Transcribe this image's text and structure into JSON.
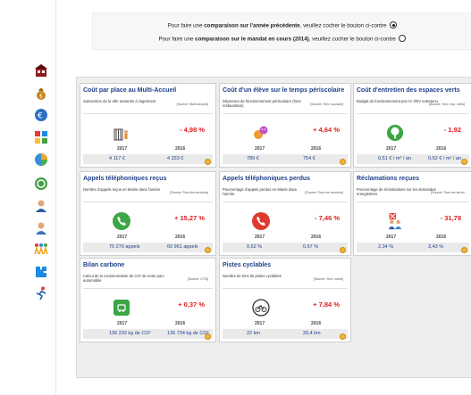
{
  "header": {
    "line1": {
      "pre": "Pour faire une ",
      "bold": "comparaison sur l'année précédente",
      "post": ", veuillez cocher le bouton ci-contre"
    },
    "line2": {
      "pre": "Pour faire une ",
      "bold": "comparaison sur le mandat en cours (2014)",
      "post": ", veuillez cocher le bouton ci-contre"
    }
  },
  "sidebar_icons": [
    "building-icon",
    "money-bag-icon",
    "euro-icon",
    "puzzle-pieces-icon",
    "pie-chart-icon",
    "recycle-icon",
    "user-icon",
    "user-group-icon",
    "people-chain-icon",
    "puzzle-icon",
    "runner-icon"
  ],
  "colors": {
    "title": "#1f3f8a",
    "negative": "#e11b1b",
    "green": "#3aa645",
    "red": "#e03a2f"
  },
  "cards": [
    {
      "title": "Coût par place au Multi-Accueil",
      "subtitle": "Subvention de la ville ramenée à l'agrément",
      "source": "[Source: Multi-accueil]",
      "icon": "child-with-crib-icon",
      "delta": "- 4,98 %",
      "year1": "2017",
      "year2": "2016",
      "value1": "4 117  €",
      "value2": "4 333  €"
    },
    {
      "title": "Coût d'un élève sur le temps périscolaire",
      "subtitle": "Dépenses de fonctionnement périscolaire (hors restauration)",
      "source": "[Source: Serv. scolaire]",
      "icon": "theater-masks-icon",
      "delta": "+ 4,64  %",
      "year1": "2017",
      "year2": "2016",
      "value1": "789  €",
      "value2": "754  €"
    },
    {
      "title": "Coût d'entretien des espaces verts",
      "subtitle": "Budget de fonctionnement par m² d'EV entretenu",
      "source": "[Source: Serv. esp. verts]",
      "icon": "tree-icon",
      "delta": "- 1,92",
      "year1": "2017",
      "year2": "2016",
      "value1": "0,51  € / m² / an",
      "value2": "0,52  € / m² / an"
    },
    {
      "title": "Appels téléphoniques reçus",
      "subtitle": "Nombre d'appels reçus en Mairie dans l'année",
      "source": "[Source: Tous les services]",
      "icon": "phone-green-icon",
      "delta": "+ 15,27  %",
      "year1": "2017",
      "year2": "2016",
      "value1": "70 270  appels",
      "value2": "60 961  appels"
    },
    {
      "title": "Appels téléphoniques perdus",
      "subtitle": "Pourcentage d'appels perdus en Mairie dans l'année",
      "source": "[Source: Tous les services]",
      "icon": "phone-red-icon",
      "delta": "- 7,46  %",
      "year1": "2017",
      "year2": "2016",
      "value1": "0,62  %",
      "value2": "0,67  %"
    },
    {
      "title": "Réclamations reçues",
      "subtitle": "Pourcentage de réclamations sur les demandes enregistrées",
      "source": "[Source: Tous les servic",
      "icon": "complaint-people-icon",
      "delta": "- 31,78",
      "year1": "2017",
      "year2": "2016",
      "value1": "2,34  %",
      "value2": "3,43  %"
    },
    {
      "title": "Bilan carbone",
      "subtitle": "Calcul de la consommation de CO² de notre parc automobile",
      "source": "[Source: CTM]",
      "icon": "green-car-icon",
      "delta": "+ 0,37  %",
      "year1": "2017",
      "year2": "2016",
      "value1": "136 232  kg de CO²",
      "value2": "135 734  kg de CO²"
    },
    {
      "title": "Pistes cyclables",
      "subtitle": "Nombre de kms de pistes cyclables",
      "source": "[Source: Serv. voirie]",
      "icon": "bicycle-icon",
      "delta": "+ 7,84  %",
      "year1": "2017",
      "year2": "2016",
      "value1": "22  km",
      "value2": "20,4  km"
    }
  ]
}
